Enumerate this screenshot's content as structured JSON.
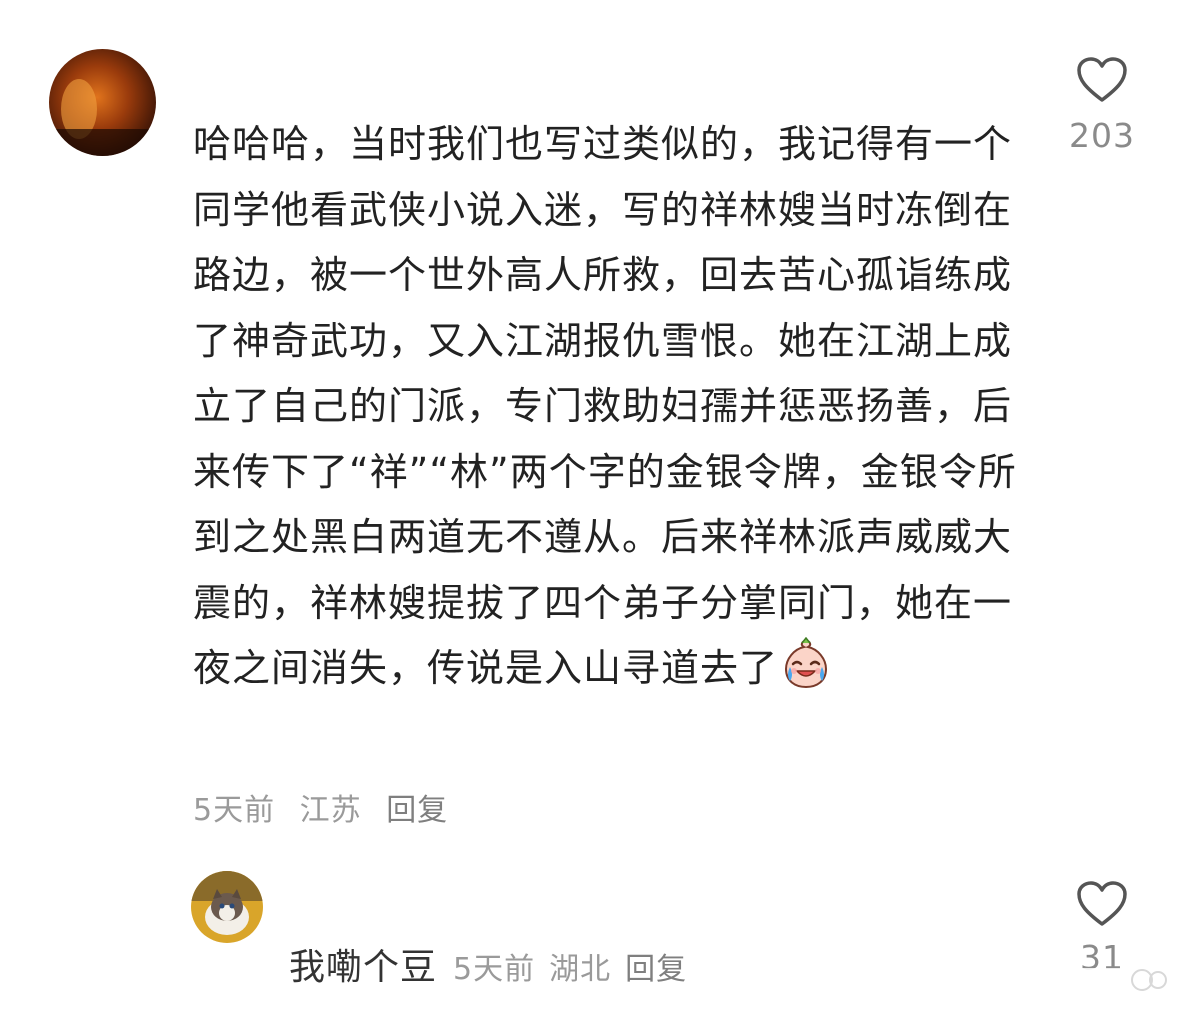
{
  "comment": {
    "text": "哈哈哈，当时我们也写过类似的，我记得有一个同学他看武侠小说入迷，写的祥林嫂当时冻倒在路边，被一个世外高人所救，回去苦心孤诣练成了神奇武功，又入江湖报仇雪恨。她在江湖上成立了自己的门派，专门救助妇孺并惩恶扬善，后来传下了“祥”“林”两个字的金银令牌，金银令所到之处黑白两道无不遵从。后来祥林派声威威大震的，祥林嫂提拔了四个弟子分掌同门，她在一夜之间消失，传说是入山寻道去了",
    "emoji": "crying-laughing-emoji",
    "time": "5天前",
    "location": "江苏",
    "reply_label": "回复",
    "likes": "203"
  },
  "reply": {
    "username": "我嘞个豆",
    "time": "5天前",
    "location": "湖北",
    "reply_label": "回复",
    "likes": "31"
  },
  "colors": {
    "text": "#222222",
    "meta": "#9a9a9a",
    "icon": "#555555"
  }
}
